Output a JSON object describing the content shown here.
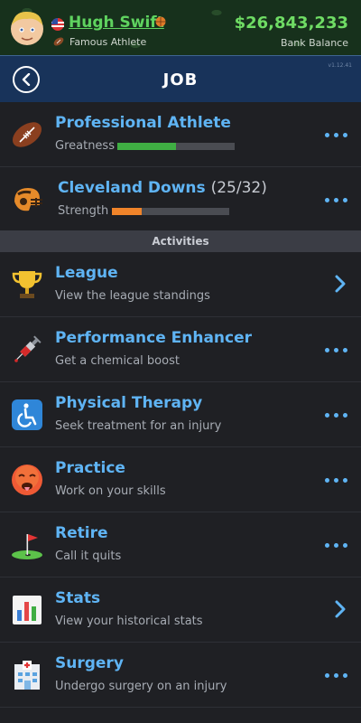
{
  "header": {
    "name": "Hugh Swift",
    "subtitle": "Famous Athlete",
    "balance": "$26,843,233",
    "balance_label": "Bank Balance",
    "version": "v1.12.41"
  },
  "nav": {
    "title": "JOB"
  },
  "job": {
    "title": "Professional Athlete",
    "stat_label": "Greatness",
    "stat_value": 0.5,
    "stat_color": "#3fae43"
  },
  "team": {
    "title": "Cleveland Downs",
    "count": "(25/32)",
    "stat_label": "Strength",
    "stat_value": 0.25,
    "stat_color": "#f0842a"
  },
  "section_label": "Activities",
  "activities": [
    {
      "title": "League",
      "subtitle": "View the league standings",
      "icon": "trophy-icon",
      "action": "chevron"
    },
    {
      "title": "Performance Enhancer",
      "subtitle": "Get a chemical boost",
      "icon": "syringe-icon",
      "action": "dots"
    },
    {
      "title": "Physical Therapy",
      "subtitle": "Seek treatment for an injury",
      "icon": "wheelchair-icon",
      "action": "dots"
    },
    {
      "title": "Practice",
      "subtitle": "Work on your skills",
      "icon": "hot-face-icon",
      "action": "dots"
    },
    {
      "title": "Retire",
      "subtitle": "Call it quits",
      "icon": "golf-flag-icon",
      "action": "dots"
    },
    {
      "title": "Stats",
      "subtitle": "View your historical stats",
      "icon": "bar-chart-icon",
      "action": "chevron"
    },
    {
      "title": "Surgery",
      "subtitle": "Undergo surgery on an injury",
      "icon": "hospital-icon",
      "action": "dots"
    }
  ],
  "colors": {
    "accent": "#5fb4f4",
    "money": "#6fdc64",
    "navbar": "#18335a",
    "background": "#1f2024"
  }
}
